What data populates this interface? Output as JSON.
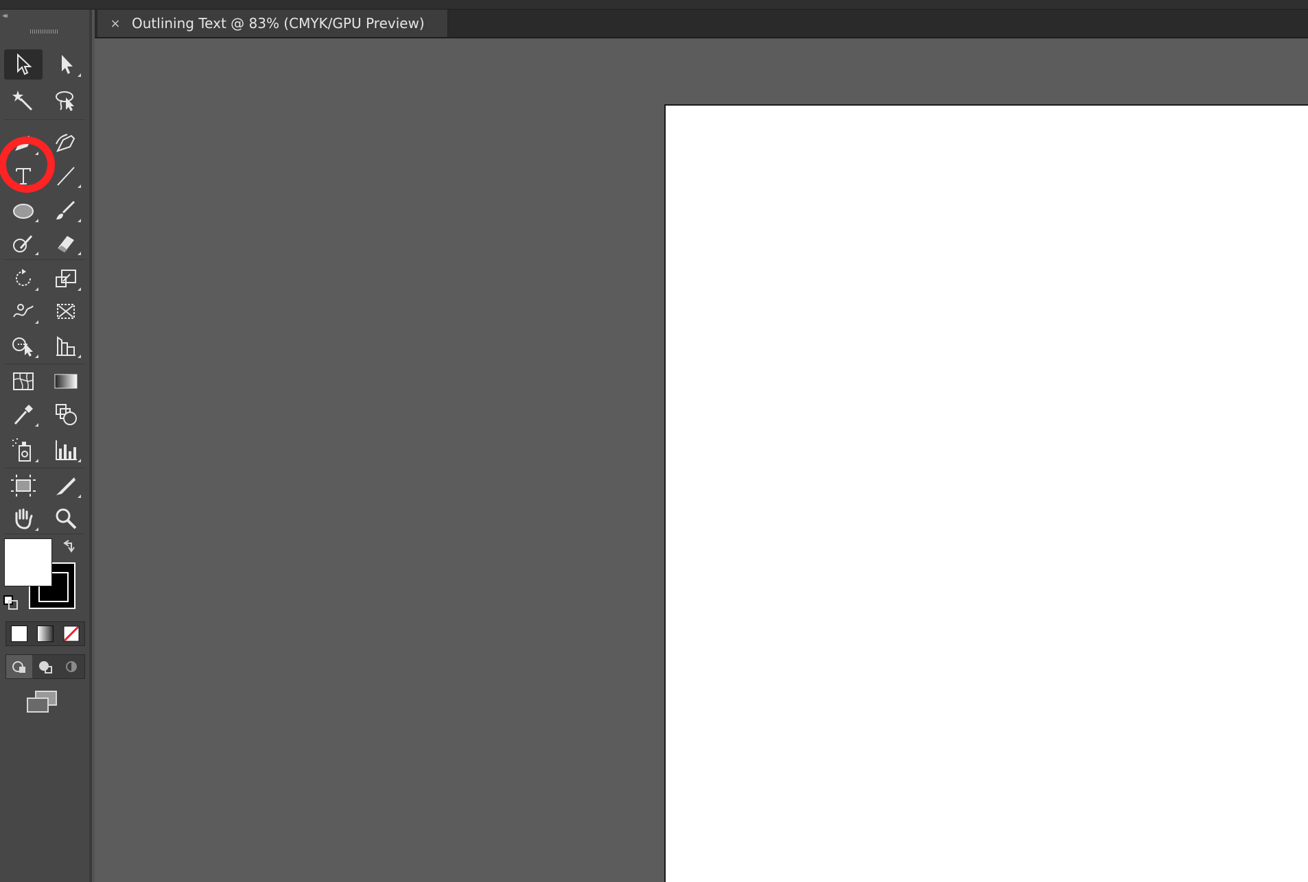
{
  "document": {
    "tab_title": "Outlining Text @ 83% (CMYK/GPU Preview)",
    "close_glyph": "×"
  },
  "toolbar": {
    "collapse_glyph": "◂◂",
    "tools": [
      {
        "id": "selection",
        "icon": "selection-arrow-icon"
      },
      {
        "id": "direct-selection",
        "icon": "direct-selection-arrow-icon"
      },
      {
        "id": "magic-wand",
        "icon": "magic-wand-icon"
      },
      {
        "id": "lasso",
        "icon": "lasso-icon"
      },
      {
        "id": "pen",
        "icon": "pen-icon"
      },
      {
        "id": "curvature",
        "icon": "curvature-pen-icon"
      },
      {
        "id": "type",
        "icon": "type-icon",
        "label": "T"
      },
      {
        "id": "line",
        "icon": "line-segment-icon"
      },
      {
        "id": "ellipse",
        "icon": "ellipse-icon"
      },
      {
        "id": "paintbrush",
        "icon": "paintbrush-icon"
      },
      {
        "id": "shaper",
        "icon": "shaper-icon"
      },
      {
        "id": "eraser",
        "icon": "eraser-icon"
      },
      {
        "id": "rotate",
        "icon": "rotate-icon"
      },
      {
        "id": "scale",
        "icon": "scale-icon"
      },
      {
        "id": "warp",
        "icon": "warp-icon"
      },
      {
        "id": "free-transform",
        "icon": "free-transform-icon"
      },
      {
        "id": "shape-builder",
        "icon": "shape-builder-icon"
      },
      {
        "id": "perspective-grid",
        "icon": "perspective-grid-icon"
      },
      {
        "id": "mesh",
        "icon": "mesh-icon"
      },
      {
        "id": "gradient",
        "icon": "gradient-icon"
      },
      {
        "id": "eyedropper",
        "icon": "eyedropper-icon"
      },
      {
        "id": "blend",
        "icon": "blend-icon"
      },
      {
        "id": "symbol-sprayer",
        "icon": "symbol-sprayer-icon"
      },
      {
        "id": "column-graph",
        "icon": "column-graph-icon"
      },
      {
        "id": "artboard",
        "icon": "artboard-icon"
      },
      {
        "id": "slice",
        "icon": "slice-icon"
      },
      {
        "id": "hand",
        "icon": "hand-icon"
      },
      {
        "id": "zoom",
        "icon": "zoom-icon"
      }
    ],
    "colors": {
      "fill": "#ffffff",
      "stroke": "#000000",
      "highlight": "#ff2323"
    }
  }
}
